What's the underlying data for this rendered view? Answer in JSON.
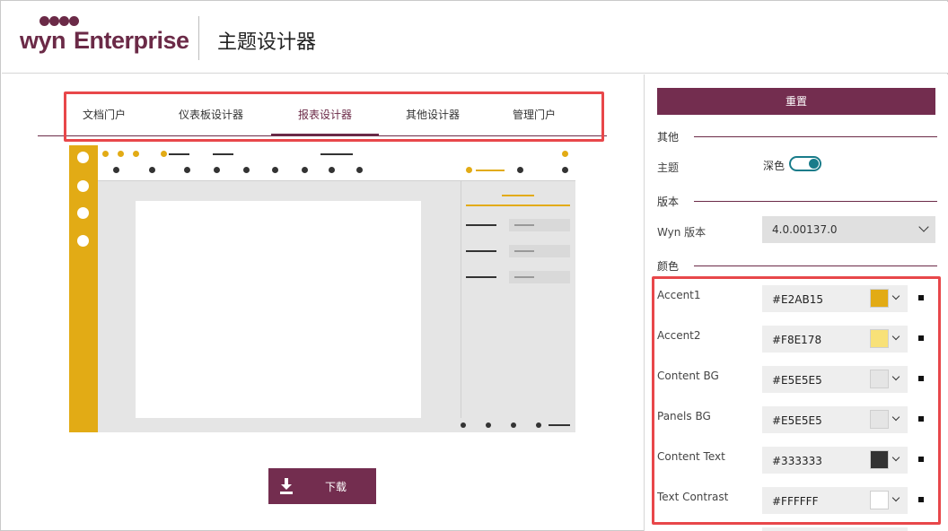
{
  "header": {
    "logo_wyn": "wyn",
    "logo_enterprise": "Enterprise",
    "title": "主题设计器"
  },
  "tabs": [
    {
      "label": "文档门户",
      "active": false
    },
    {
      "label": "仪表板设计器",
      "active": false
    },
    {
      "label": "报表设计器",
      "active": true
    },
    {
      "label": "其他设计器",
      "active": false
    },
    {
      "label": "管理门户",
      "active": false
    }
  ],
  "preview": {
    "accent": "#E2AB15",
    "background": "#E5E5E5"
  },
  "download": {
    "icon": "download-icon",
    "label": "下载"
  },
  "panel": {
    "reset_label": "重置",
    "section_other": "其他",
    "theme_label": "主题",
    "theme_value": "深色",
    "theme_toggle_on": true,
    "section_version": "版本",
    "version_label": "Wyn 版本",
    "version_value": "4.0.00137.0",
    "section_colors": "颜色",
    "colors": [
      {
        "label": "Accent1",
        "hex": "#E2AB15",
        "swatch": "#E2AB15"
      },
      {
        "label": "Accent2",
        "hex": "#F8E178",
        "swatch": "#F8E178"
      },
      {
        "label": "Content BG",
        "hex": "#E5E5E5",
        "swatch": "#E5E5E5"
      },
      {
        "label": "Panels BG",
        "hex": "#E5E5E5",
        "swatch": "#E5E5E5"
      },
      {
        "label": "Content Text",
        "hex": "#333333",
        "swatch": "#333333"
      },
      {
        "label": "Text Contrast",
        "hex": "#FFFFFF",
        "swatch": "#FFFFFF"
      }
    ]
  },
  "brand_color": "#732D4F",
  "highlight_color": "#E8474A"
}
